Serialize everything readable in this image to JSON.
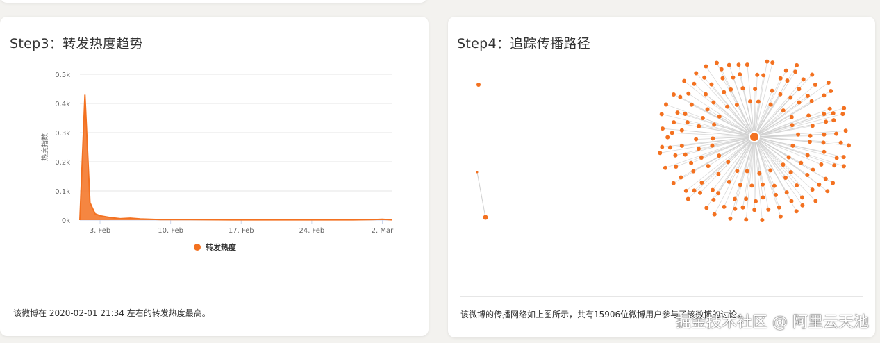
{
  "step3": {
    "title": "Step3：转发热度趋势",
    "description": "该微博在 2020-02-01 21:34 左右的转发热度最高。"
  },
  "step4": {
    "title": "Step4：追踪传播路径",
    "description": "该微博的传播网络如上图所示，共有15906位微博用户参与了该微博的讨论。"
  },
  "watermark": "掘金技术社区 @ 阿里云天池",
  "colors": {
    "accent": "#f37120",
    "grid": "#e6e6e6",
    "edge": "#cfcfcf"
  },
  "chart_data": {
    "type": "area",
    "title": "",
    "xlabel": "",
    "ylabel": "热度指数",
    "ylim": [
      0,
      500
    ],
    "y_ticks": [
      "0k",
      "0.1k",
      "0.2k",
      "0.3k",
      "0.4k",
      "0.5k"
    ],
    "x_ticks": [
      "3. Feb",
      "10. Feb",
      "17. Feb",
      "24. Feb",
      "2. Mar"
    ],
    "series": [
      {
        "name": "转发热度",
        "x": [
          "2020-02-01",
          "2020-02-01T12",
          "2020-02-02",
          "2020-02-02T12",
          "2020-02-03",
          "2020-02-04",
          "2020-02-05",
          "2020-02-06",
          "2020-02-07",
          "2020-02-09",
          "2020-02-12",
          "2020-02-16",
          "2020-02-20",
          "2020-02-25",
          "2020-02-28",
          "2020-03-01",
          "2020-03-02",
          "2020-03-03"
        ],
        "values": [
          0,
          430,
          60,
          22,
          15,
          9,
          5,
          7,
          4,
          2,
          2,
          1,
          1,
          1,
          1,
          2,
          3,
          1
        ]
      }
    ],
    "legend": "bottom-center"
  }
}
